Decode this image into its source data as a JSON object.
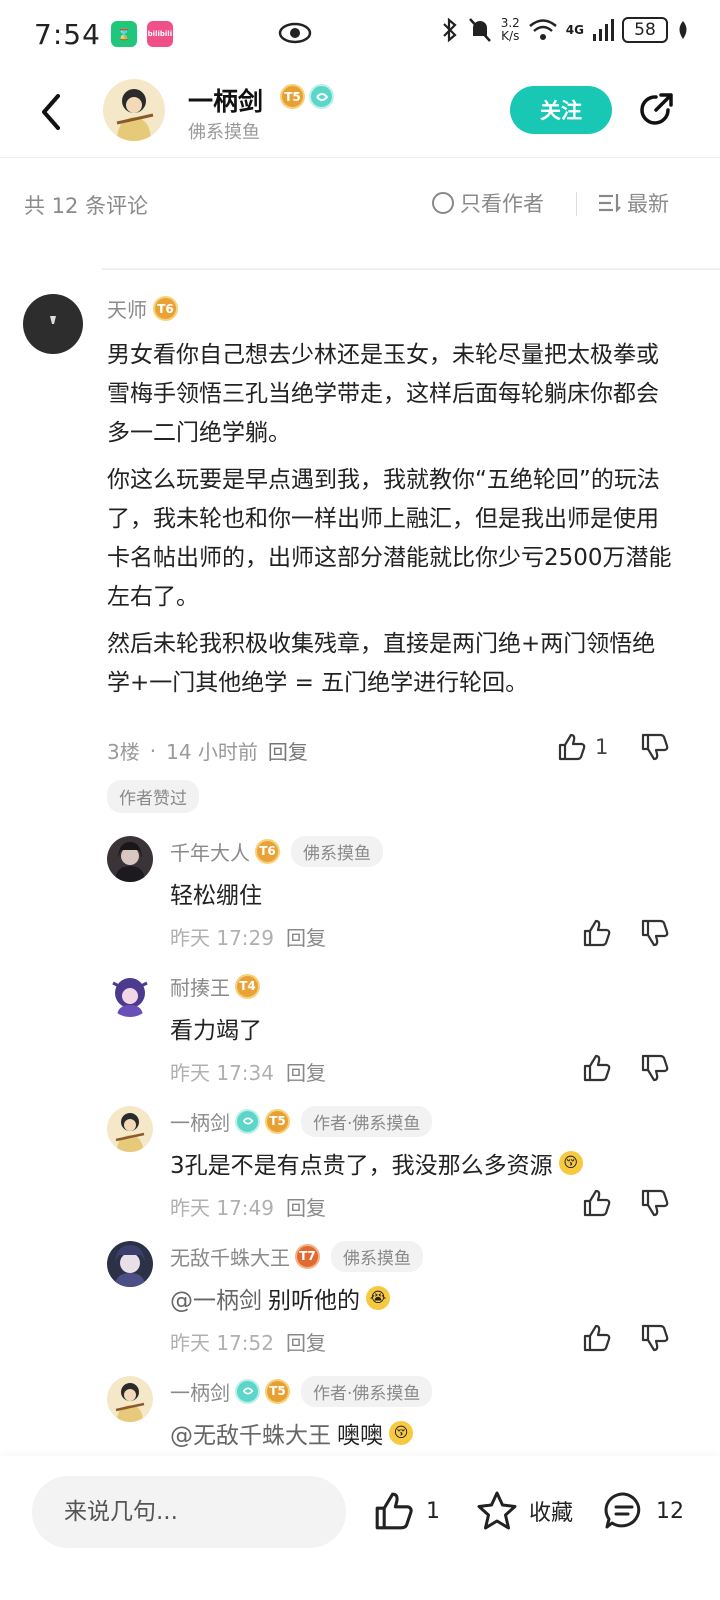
{
  "status_bar": {
    "time": "7:54",
    "app_icon_1": "",
    "app_icon_2": "bilibili",
    "net_speed_top": "3.2",
    "net_speed_bottom": "K/s",
    "network": "4G",
    "battery": "58"
  },
  "header": {
    "user_name": "一柄剑",
    "user_tag": "佛系摸鱼",
    "level_badge": "T5",
    "follow_label": "关注"
  },
  "filter": {
    "count_label": "共 12 条评论",
    "author_only_label": "只看作者",
    "sort_label": "最新"
  },
  "main_comment": {
    "name": "天师",
    "level": "T6",
    "paragraphs": [
      "男女看你自己想去少林还是玉女，未轮尽量把太极拳或雪梅手领悟三孔当绝学带走，这样后面每轮躺床你都会多一二门绝学躺。",
      "你这么玩要是早点遇到我，我就教你“五绝轮回”的玩法了，我未轮也和你一样出师上融汇，但是我出师是使用卡名帖出师的，出师这部分潜能就比你少亏2500万潜能左右了。",
      "然后未轮我积极收集残章，直接是两门绝+两门领悟绝学+一门其他绝学 = 五门绝学进行轮回。"
    ],
    "floor": "3楼",
    "sep": "·",
    "time": "14 小时前",
    "reply_label": "回复",
    "like_count": "1",
    "author_liked": "作者赞过"
  },
  "replies": [
    {
      "name": "千年大人",
      "level": "T6",
      "tag": "佛系摸鱼",
      "mention": "",
      "text": "轻松绷住",
      "emoji": "",
      "time": "昨天 17:29",
      "reply_label": "回复"
    },
    {
      "name": "耐揍王",
      "level": "T4",
      "tag": "",
      "mention": "",
      "text": "看力竭了",
      "emoji": "",
      "time": "昨天 17:34",
      "reply_label": "回复"
    },
    {
      "name": "一柄剑",
      "level": "T5",
      "tag": "作者·佛系摸鱼",
      "mention": "",
      "text": "3孔是不是有点贵了，我没那么多资源",
      "emoji": "😚",
      "time": "昨天 17:49",
      "reply_label": "回复"
    },
    {
      "name": "无敌千蛛大王",
      "level": "T7",
      "tag": "佛系摸鱼",
      "mention": "@一柄剑",
      "text": "别听他的",
      "emoji": "😭",
      "time": "昨天 17:52",
      "reply_label": "回复"
    },
    {
      "name": "一柄剑",
      "level": "T5",
      "tag": "作者·佛系摸鱼",
      "mention": "@无敌千蛛大王",
      "text": "噢噢",
      "emoji": "😚",
      "time": "",
      "reply_label": ""
    }
  ],
  "bottom_bar": {
    "input_placeholder": "来说几句...",
    "like_count": "1",
    "collect_label": "收藏",
    "comment_count": "12"
  }
}
